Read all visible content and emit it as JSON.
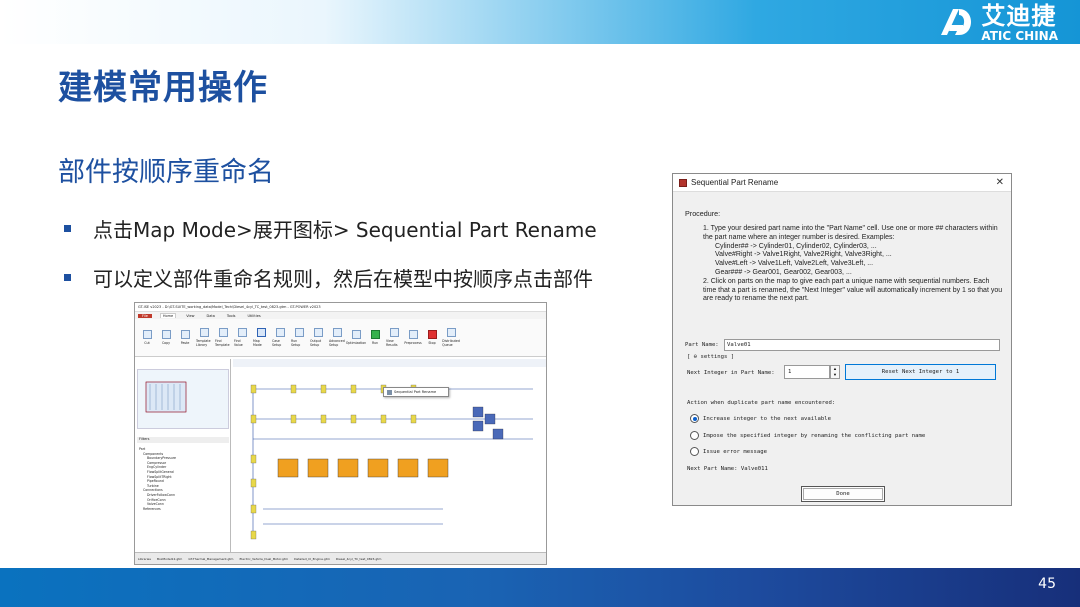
{
  "brand": {
    "cn": "艾迪捷",
    "en": "ATIC CHINA"
  },
  "slide": {
    "title": "建模常用操作",
    "subtitle": "部件按顺序重命名",
    "bullets": [
      "点击Map Mode>展开图标> Sequential Part Rename",
      "可以定义部件重命名规则，然后在模型中按顺序点击部件"
    ],
    "page_number": "45"
  },
  "app": {
    "title": "GT-ISE v2023 - D:\\GT-SUITE_working_data\\Model_Tech\\Diesel_4cyl_TC_test_0823.gtm - GT-POWER v2023",
    "tabs": [
      "File",
      "Home",
      "View",
      "Data",
      "Tools",
      "Utilities"
    ],
    "ribbon": [
      "Cut",
      "Copy",
      "Paste",
      "Template Library",
      "Find Template",
      "Find Value",
      "Map Mode",
      "Case Setup",
      "Run Setup",
      "Output Setup",
      "Advanced Setup",
      "Optimization",
      "Run",
      "View Results",
      "Preprocess",
      "Stop",
      "Distributed Queue"
    ],
    "popup_item": "Sequential Part Rename",
    "panels": {
      "filters": "Filters",
      "tree_root": "Part"
    },
    "tree_items": [
      "Components",
      "BoundaryPressure",
      "Compressor",
      "EngCylinder",
      "FlowSplitGeneral",
      "FlowSplitTRight",
      "PipeRound",
      "Turbine",
      "Connections",
      "DriverFollowConn",
      "OrificeConn",
      "ValveConn",
      "References"
    ],
    "status_tabs": [
      "Libraries",
      "BoxModel12.gtm",
      "GT-Thermal_Management.gtm",
      "Electric_Vehicle_Dual_Motor.gtm",
      "Detailed_CI_Engine.gtm",
      "Diesel_4cyl_TC_test_0823.gtm"
    ]
  },
  "dialog": {
    "title": "Sequential Part Rename",
    "procedure_label": "Procedure:",
    "step1": "1.  Type your desired part name into the \"Part Name\" cell. Use one or more ## characters within the part name where an integer number is desired. Examples:",
    "examples": [
      "Cylinder## -> Cylinder01, Cylinder02, Cylinder03, ...",
      "Valve#Right -> Valve1Right, Valve2Right, Valve3Right, ...",
      "Valve#Left -> Valve1Left, Valve2Left, Valve3Left, ...",
      "Gear### -> Gear001, Gear002, Gear003, ..."
    ],
    "step2": "2.  Click on parts on the map to give each part a unique name with sequential numbers. Each time that a part is renamed, the \"Next Integer\" value will automatically increment by 1 so that you are ready to rename the next part.",
    "part_name_label": "Part Name:",
    "part_name_value": "Valve01",
    "settings_label": "[ ⊖ settings ]",
    "next_integer_label": "Next Integer in Part Name:",
    "next_integer_value": "1",
    "reset_button": "Reset Next Integer to 1",
    "duplicate_label": "Action when duplicate part name encountered:",
    "options": [
      {
        "label": "Increase integer to the next available",
        "selected": true
      },
      {
        "label": "Impose the specified integer by renaming the conflicting part name",
        "selected": false
      },
      {
        "label": "Issue error message",
        "selected": false
      }
    ],
    "next_part_label": "Next Part Name: Valve011",
    "done_button": "Done"
  }
}
